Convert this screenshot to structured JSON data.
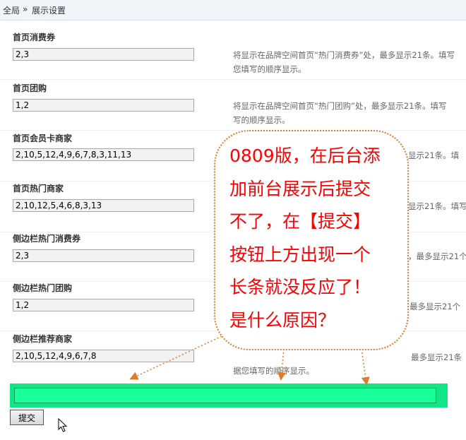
{
  "breadcrumb": {
    "home": "全局",
    "separator": "»",
    "current": "展示设置"
  },
  "rows": [
    {
      "label": "首页消费券",
      "value": "2,3",
      "hint_line1": "将显示在品牌空间首页“热门消费券”处，最多显示21条。填写",
      "hint_line2": "您填写的顺序显示。"
    },
    {
      "label": "首页团购",
      "value": "1,2",
      "hint_line1": "将显示在品牌空间首页“热门团购”处，最多显示21条。填写",
      "hint_line2": "写的顺序显示。"
    },
    {
      "label": "首页会员卡商家",
      "value": "2,10,5,12,4,9,6,7,8,3,11,13",
      "hint_partial": "显示21条。填"
    },
    {
      "label": "首页热门商家",
      "value": "2,10,12,5,4,6,8,3,13",
      "hint_partial": "显示21条。填写"
    },
    {
      "label": "侧边栏热门消费券",
      "value": "2,3",
      "hint_partial": "，最多显示21个"
    },
    {
      "label": "侧边栏热门团购",
      "value": "1,2",
      "hint_partial": "最多显示21个"
    },
    {
      "label": "侧边栏推荐商家",
      "value": "2,10,5,12,4,9,6,7,8",
      "hint_partial": "最多显示21条",
      "hint_line2": "据您填写的顺序显示。"
    }
  ],
  "submit_label": "提交",
  "callout": "0809版，在后台添\n加前台展示后提交\n不了，在【提交】\n按钮上方出现一个\n长条就没反应了！\n是什么原因？",
  "colors": {
    "callout_text": "#ff0000",
    "callout_border": "#e07b2a",
    "bar": "#10e686",
    "bar_inner": "#19ff9a"
  },
  "icons": {
    "cursor": "mouse-pointer-icon"
  }
}
